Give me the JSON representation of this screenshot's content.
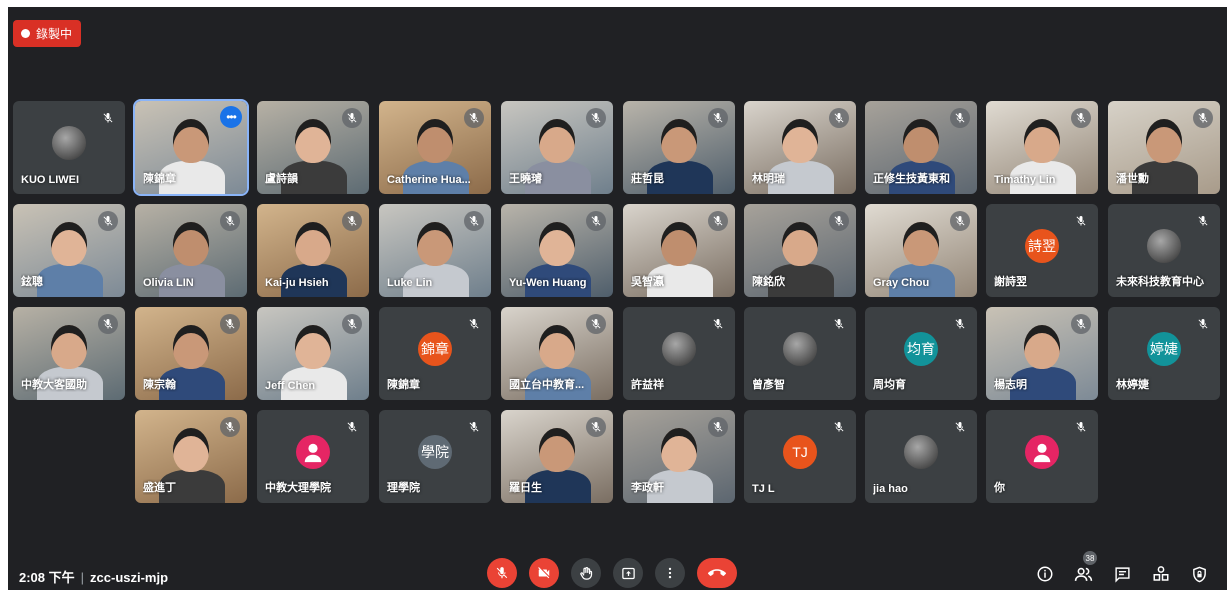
{
  "recording": {
    "label": "錄製中"
  },
  "meeting": {
    "time": "2:08 下午",
    "separator": "|",
    "code": "zcc-uszi-mjp"
  },
  "participants_count": "38",
  "tiles": [
    {
      "name": "KUO LIWEI",
      "kind": "photo"
    },
    {
      "name": "陳錦章",
      "kind": "video",
      "more": true,
      "selected": true
    },
    {
      "name": "盧詩韻",
      "kind": "video"
    },
    {
      "name": "Catherine Hua...",
      "kind": "video"
    },
    {
      "name": "王曉璿",
      "kind": "video"
    },
    {
      "name": "莊哲昆",
      "kind": "video"
    },
    {
      "name": "林明瑞",
      "kind": "video"
    },
    {
      "name": "正修生技黃東和",
      "kind": "video"
    },
    {
      "name": "Timathy Lin",
      "kind": "video"
    },
    {
      "name": "潘世勳",
      "kind": "video"
    },
    {
      "name": "鉉聰",
      "kind": "video"
    },
    {
      "name": "Olivia LIN",
      "kind": "video"
    },
    {
      "name": "Kai-ju Hsieh",
      "kind": "video"
    },
    {
      "name": "Luke Lin",
      "kind": "video"
    },
    {
      "name": "Yu-Wen Huang",
      "kind": "video"
    },
    {
      "name": "吳智瀛",
      "kind": "video"
    },
    {
      "name": "陳銘欣",
      "kind": "video"
    },
    {
      "name": "Gray Chou",
      "kind": "video"
    },
    {
      "name": "謝詩翌",
      "kind": "avatar",
      "initials": "詩翌",
      "color": "#e8541c"
    },
    {
      "name": "未來科技教育中心",
      "kind": "photo"
    },
    {
      "name": "中教大客國助",
      "kind": "video"
    },
    {
      "name": "陳宗翰",
      "kind": "video"
    },
    {
      "name": "Jeff Chen",
      "kind": "video"
    },
    {
      "name": "陳錦章",
      "kind": "avatar",
      "initials": "錦章",
      "color": "#e8541c"
    },
    {
      "name": "國立台中教育...",
      "kind": "video"
    },
    {
      "name": "許益祥",
      "kind": "photo"
    },
    {
      "name": "曾彥智",
      "kind": "photo"
    },
    {
      "name": "周均育",
      "kind": "avatar",
      "initials": "均育",
      "color": "#12939a"
    },
    {
      "name": "楊志明",
      "kind": "video"
    },
    {
      "name": "林婷婕",
      "kind": "avatar",
      "initials": "婷婕",
      "color": "#12939a"
    },
    {
      "name": "盛進丁",
      "kind": "video"
    },
    {
      "name": "中教大理學院",
      "kind": "person",
      "color": "#e52564"
    },
    {
      "name": "理學院",
      "kind": "avatar",
      "initials": "學院",
      "color": "#5f6a74"
    },
    {
      "name": "羅日生",
      "kind": "video"
    },
    {
      "name": "李政軒",
      "kind": "video"
    },
    {
      "name": "TJ L",
      "kind": "avatar",
      "initials": "TJ",
      "color": "#e8541c"
    },
    {
      "name": "jia hao",
      "kind": "photo"
    },
    {
      "name": "你",
      "kind": "person",
      "color": "#e52564"
    }
  ],
  "controls": [
    "mic-off",
    "camera-off",
    "raise-hand",
    "present",
    "more-options",
    "end-call"
  ],
  "right_icons": [
    "info",
    "people",
    "chat",
    "activities",
    "host-controls"
  ]
}
